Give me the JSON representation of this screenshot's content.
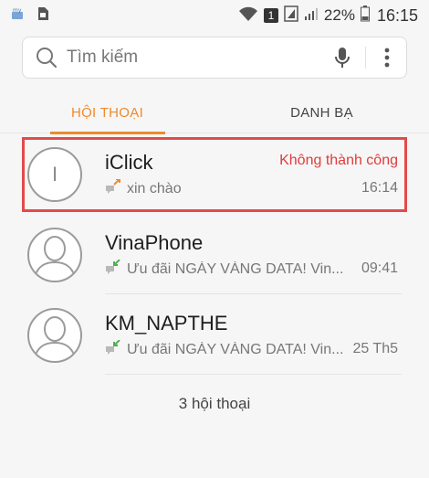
{
  "status_bar": {
    "battery_percent": "22%",
    "time": "16:15",
    "sim_badge": "1"
  },
  "search": {
    "placeholder": "Tìm kiếm"
  },
  "tabs": [
    {
      "label": "HỘI THOẠI",
      "active": true
    },
    {
      "label": "DANH BẠ",
      "active": false
    }
  ],
  "conversations": [
    {
      "name": "iClick",
      "avatar_letter": "I",
      "preview": "xin chào",
      "status": "Không thành công",
      "time": "16:14",
      "direction": "outgoing"
    },
    {
      "name": "VinaPhone",
      "preview": "Ưu đãi NGÀY VÀNG DATA! Vin...",
      "time": "09:41",
      "direction": "incoming"
    },
    {
      "name": "KM_NAPTHE",
      "preview": "Ưu đãi NGÀY VÀNG DATA! Vin...",
      "time": "25 Th5",
      "direction": "incoming"
    }
  ],
  "footer": {
    "count_label": "3 hội thoại"
  },
  "colors": {
    "accent": "#ee8a2c",
    "error": "#e23b3b",
    "highlight_box": "#e34a4a"
  }
}
